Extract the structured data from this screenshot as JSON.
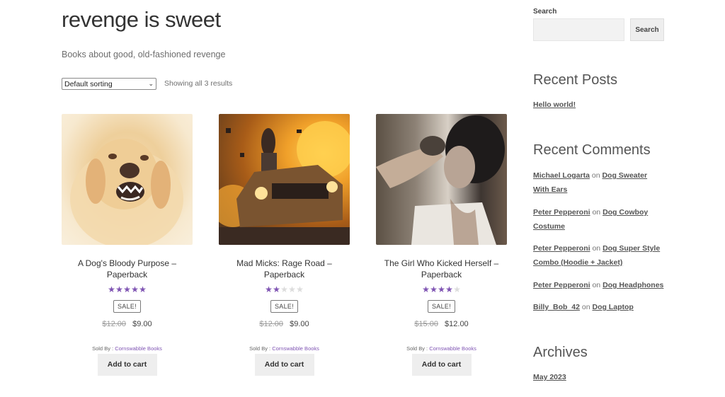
{
  "page": {
    "title": "revenge is sweet",
    "description": "Books about good, old-fashioned revenge"
  },
  "toolbar": {
    "sorting_selected": "Default sorting",
    "result_count": "Showing all 3 results"
  },
  "products": [
    {
      "name": "A Dog's Bloody Purpose – Paperback",
      "image": "angry-dog-image",
      "rating": 5,
      "rating_max": 5,
      "badge": "SALE!",
      "regular_price": "$12.00",
      "sale_price": "$9.00",
      "sold_by_label": "Sold By :",
      "vendor": "Cornswabble Books",
      "button": "Add to cart"
    },
    {
      "name": "Mad Micks: Rage Road – Paperback",
      "image": "car-explosion-image",
      "rating": 2,
      "rating_max": 5,
      "badge": "SALE!",
      "regular_price": "$12.00",
      "sale_price": "$9.00",
      "sold_by_label": "Sold By :",
      "vendor": "Cornswabble Books",
      "button": "Add to cart"
    },
    {
      "name": "The Girl Who Kicked Herself – Paperback",
      "image": "tattooed-woman-image",
      "rating": 4,
      "rating_max": 5,
      "badge": "SALE!",
      "regular_price": "$15.00",
      "sale_price": "$12.00",
      "sold_by_label": "Sold By :",
      "vendor": "Cornswabble Books",
      "button": "Add to cart"
    }
  ],
  "sidebar": {
    "search": {
      "label": "Search",
      "placeholder": "",
      "value": "",
      "button": "Search"
    },
    "recent_posts": {
      "title": "Recent Posts",
      "items": [
        "Hello world!"
      ]
    },
    "recent_comments": {
      "title": "Recent Comments",
      "connector": "on",
      "items": [
        {
          "author": "Michael Logarta",
          "post": "Dog Sweater With Ears"
        },
        {
          "author": "Peter Pepperoni",
          "post": "Dog Cowboy Costume"
        },
        {
          "author": "Peter Pepperoni",
          "post": "Dog Super Style Combo (Hoodie + Jacket)"
        },
        {
          "author": "Peter Pepperoni",
          "post": "Dog Headphones"
        },
        {
          "author": "Billy_Bob_42",
          "post": "Dog Laptop"
        }
      ]
    },
    "archives": {
      "title": "Archives",
      "items": [
        "May 2023"
      ]
    }
  },
  "colors": {
    "accent": "#7f54b3",
    "star_off": "#dcdcdc",
    "button_bg": "#eeeeee"
  }
}
